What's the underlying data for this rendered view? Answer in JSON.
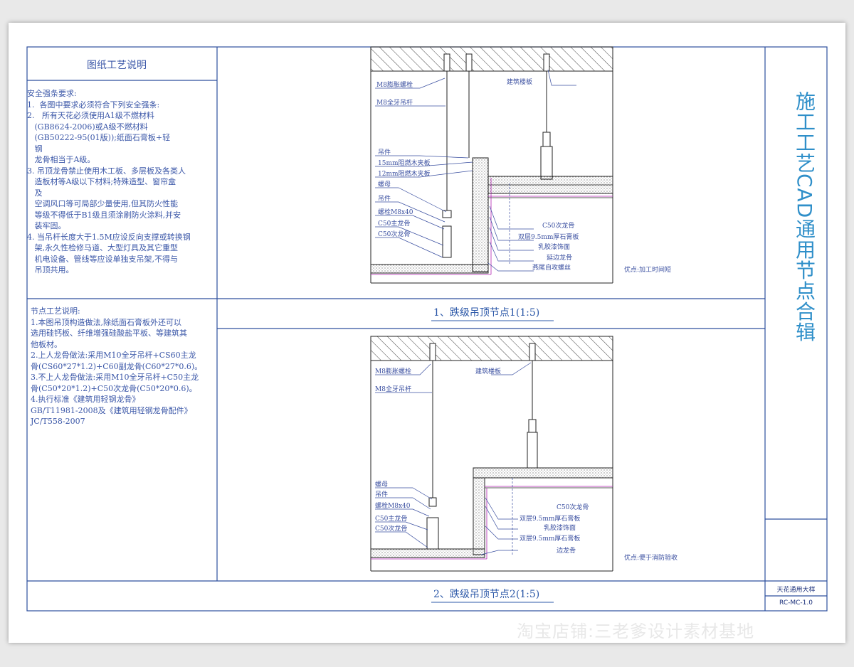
{
  "notes_panel": {
    "title": "图纸工艺说明",
    "safety_text": "安全强条要求:\n1.  各图中要求必须符合下列安全强条:\n2.   所有天花必须使用A1级不燃材料\n   (GB8624-2006)或A级不燃材料\n   (GB50222-95(01版));纸面石膏板+轻\n   钢\n   龙骨相当于A级。\n3. 吊顶龙骨禁止使用木工板、多层板及各类人\n   造板材等A级以下材料;特殊造型、窗帘盒\n   及\n   空调风口等可局部少量使用,但其防火性能\n   等级不得低于B1级且须涂刷防火涂料,并安\n   装牢固。\n4. 当吊杆长度大于1.5M应设反向支撑或转换钢\n   架,永久性检修马道、大型灯具及其它重型\n   机电设备、管线等应设单独支吊架,不得与\n   吊顶共用。",
    "node_text": "节点工艺说明:\n1.本图吊顶构造做法,除纸面石膏板外还可以\n选用硅钙板、纤维增强硅酸盐平板、等建筑其\n他板材。\n2.上人龙骨做法:采用M10全牙吊杆+CS60主龙\n骨(CS60*27*1.2)+C60副龙骨(C60*27*0.6)。\n3.不上人龙骨做法:采用M10全牙吊杆+C50主龙\n骨(C50*20*1.2)+C50次龙骨(C50*20*0.6)。\n4.执行标准《建筑用轻钢龙骨》\nGB/T11981-2008及《建筑用轻钢龙骨配件》\nJC/T558-2007"
  },
  "detail1": {
    "caption": "1、跌级吊顶节点1(1:5)",
    "advantage": "优点:加工时间短",
    "labels_left": [
      "M8膨胀螺栓",
      "M8全牙吊杆",
      "吊件",
      "15mm阻燃木夹板",
      "12mm阻燃木夹板",
      "螺母",
      "吊件",
      "螺栓M8x40",
      "C50主龙骨",
      "C50次龙骨"
    ],
    "labels_right_top": [
      "建筑楼板"
    ],
    "labels_right": [
      "C50次龙骨",
      "双层9.5mm厚石膏板",
      "乳胶漆饰面",
      "延边龙骨",
      "燕尾自攻螺丝"
    ]
  },
  "detail2": {
    "caption": "2、跌级吊顶节点2(1:5)",
    "advantage": "优点:便于消防验收",
    "labels_left": [
      "M8膨胀螺栓",
      "M8全牙吊杆",
      "螺母",
      "吊件",
      "螺栓M8x40",
      "C50主龙骨",
      "C50次龙骨"
    ],
    "labels_right_top": [
      "建筑楼板"
    ],
    "labels_right": [
      "C50次龙骨",
      "双层9.5mm厚石膏板",
      "乳胶漆饰面",
      "双层9.5mm厚石膏板",
      "边龙骨"
    ]
  },
  "title_block": {
    "vertical_title": "施工工艺CAD通用节点合辑",
    "sheet_name": "天花通用大样",
    "sheet_code": "RC-MC-1.0"
  },
  "watermark": "淘宝店铺:三老爹设计素材基地",
  "colors": {
    "frame": "#2d4f9e",
    "text": "#3b57a8",
    "title": "#2f8fc9",
    "leader": "#3a4fa0"
  }
}
